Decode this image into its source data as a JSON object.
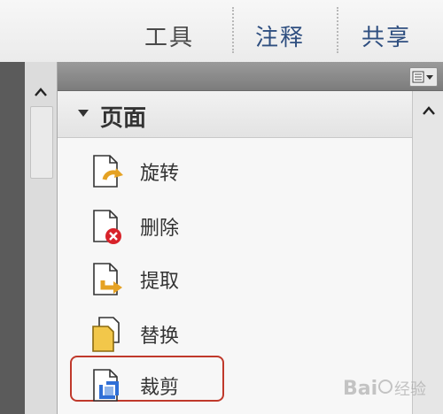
{
  "toolbar": {
    "tools_label": "工具",
    "annotate_label": "注释",
    "share_label": "共享"
  },
  "panel": {
    "section_title": "页面",
    "items": [
      {
        "label": "旋转",
        "icon": "rotate-page-icon"
      },
      {
        "label": "删除",
        "icon": "delete-page-icon"
      },
      {
        "label": "提取",
        "icon": "extract-page-icon"
      },
      {
        "label": "替换",
        "icon": "replace-page-icon"
      },
      {
        "label": "裁剪",
        "icon": "crop-page-icon"
      }
    ],
    "highlighted_item": "裁剪"
  },
  "colors": {
    "annotate_tab": "#2f4f80",
    "share_tab": "#2f4f80",
    "highlight_border": "#c0392b"
  },
  "watermark": {
    "text": "Bai 经验"
  }
}
